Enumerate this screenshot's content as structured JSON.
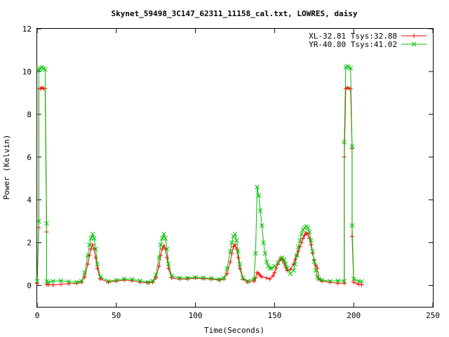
{
  "chart_data": {
    "type": "line",
    "title": "Skynet_59498_3C147_62311_11158_cal.txt, LOWRES, daisy",
    "xlabel": "Time(Seconds)",
    "ylabel": "Power (Kelvin)",
    "xlim": [
      0,
      250
    ],
    "ylim": [
      -1,
      12
    ],
    "xticks": [
      "0",
      "50",
      "100",
      "150",
      "200",
      "250"
    ],
    "yticks": [
      "0",
      "2",
      "4",
      "6",
      "8",
      "10",
      "12"
    ],
    "legend_position": "top-right",
    "grid": false,
    "series": [
      {
        "name": "XL-32.81 Tsys:32.88",
        "color": "#ff0000",
        "marker": "plus",
        "x": [
          0,
          1,
          1,
          2,
          3,
          4,
          5,
          6,
          6,
          7,
          10,
          15,
          20,
          25,
          28,
          30,
          32,
          33,
          34,
          35,
          36,
          37,
          38,
          40,
          45,
          50,
          55,
          60,
          65,
          70,
          73,
          75,
          77,
          78,
          79,
          80,
          81,
          82,
          83,
          85,
          90,
          95,
          100,
          105,
          110,
          115,
          118,
          120,
          122,
          123,
          124,
          125,
          126,
          127,
          128,
          130,
          133,
          137,
          138,
          139,
          140,
          141,
          142,
          145,
          147,
          149,
          150,
          151,
          152,
          153,
          154,
          155,
          156,
          157,
          158,
          160,
          162,
          163,
          164,
          165,
          166,
          167,
          168,
          169,
          170,
          171,
          172,
          173,
          174,
          175,
          176,
          177,
          178,
          180,
          185,
          190,
          194,
          194,
          195,
          196,
          197,
          198,
          199,
          199,
          200,
          203,
          205
        ],
        "y": [
          0.1,
          2.7,
          9.2,
          9.2,
          9.25,
          9.2,
          9.2,
          2.5,
          0.05,
          0.03,
          0.02,
          0.05,
          0.08,
          0.1,
          0.15,
          0.4,
          1.0,
          1.4,
          1.7,
          1.9,
          1.7,
          1.3,
          0.8,
          0.3,
          0.15,
          0.2,
          0.25,
          0.22,
          0.15,
          0.12,
          0.15,
          0.35,
          0.9,
          1.4,
          1.7,
          1.85,
          1.7,
          1.3,
          0.8,
          0.35,
          0.3,
          0.3,
          0.35,
          0.32,
          0.3,
          0.25,
          0.3,
          0.55,
          1.1,
          1.5,
          1.8,
          1.9,
          1.7,
          1.3,
          0.8,
          0.3,
          0.15,
          0.2,
          0.35,
          0.6,
          0.55,
          0.45,
          0.4,
          0.35,
          0.3,
          0.45,
          0.6,
          0.8,
          1.0,
          1.15,
          1.25,
          1.2,
          1.05,
          0.85,
          0.7,
          0.75,
          1.0,
          1.2,
          1.4,
          1.6,
          1.8,
          2.0,
          2.2,
          2.35,
          2.45,
          2.4,
          2.2,
          1.9,
          1.5,
          1.2,
          0.95,
          0.8,
          0.3,
          0.2,
          0.15,
          0.1,
          0.1,
          6.0,
          9.2,
          9.25,
          9.2,
          9.2,
          6.4,
          2.3,
          0.15,
          0.05,
          0.03
        ]
      },
      {
        "name": "YR-40.80 Tsys:41.02",
        "color": "#00c000",
        "marker": "x",
        "x": [
          0,
          1,
          1,
          2,
          3,
          4,
          5,
          6,
          6,
          7,
          10,
          15,
          20,
          25,
          28,
          30,
          32,
          33,
          34,
          35,
          36,
          37,
          38,
          40,
          45,
          50,
          55,
          60,
          65,
          70,
          73,
          75,
          77,
          78,
          79,
          80,
          81,
          82,
          83,
          85,
          90,
          95,
          100,
          105,
          110,
          115,
          118,
          120,
          122,
          123,
          124,
          125,
          126,
          127,
          128,
          130,
          133,
          137,
          138,
          139,
          140,
          141,
          142,
          143,
          144,
          145,
          146,
          147,
          148,
          150,
          152,
          154,
          155,
          156,
          157,
          158,
          160,
          162,
          163,
          164,
          165,
          166,
          167,
          168,
          169,
          170,
          171,
          172,
          173,
          174,
          175,
          176,
          177,
          178,
          180,
          185,
          190,
          194,
          194,
          195,
          196,
          197,
          198,
          199,
          199,
          200,
          203,
          205
        ],
        "y": [
          0.2,
          3.0,
          10.1,
          10.15,
          10.2,
          10.15,
          10.1,
          2.9,
          0.2,
          0.15,
          0.2,
          0.22,
          0.18,
          0.15,
          0.2,
          0.6,
          1.4,
          1.9,
          2.2,
          2.4,
          2.2,
          1.7,
          1.0,
          0.4,
          0.2,
          0.25,
          0.3,
          0.28,
          0.22,
          0.15,
          0.2,
          0.5,
          1.3,
          1.9,
          2.2,
          2.4,
          2.2,
          1.7,
          1.0,
          0.45,
          0.35,
          0.35,
          0.38,
          0.35,
          0.33,
          0.28,
          0.35,
          0.8,
          1.6,
          2.0,
          2.3,
          2.4,
          2.1,
          1.6,
          1.0,
          0.35,
          0.2,
          0.3,
          1.5,
          4.6,
          4.2,
          3.5,
          2.8,
          2.0,
          1.5,
          1.1,
          0.9,
          0.8,
          0.8,
          0.9,
          1.05,
          1.25,
          1.3,
          1.2,
          1.0,
          0.8,
          0.55,
          0.7,
          1.0,
          1.4,
          1.8,
          2.1,
          2.4,
          2.6,
          2.7,
          2.75,
          2.7,
          2.5,
          2.1,
          1.6,
          1.1,
          0.7,
          0.4,
          0.3,
          0.25,
          0.2,
          0.22,
          0.2,
          6.7,
          10.2,
          10.25,
          10.2,
          10.15,
          6.5,
          2.8,
          0.3,
          0.2,
          0.18
        ]
      }
    ]
  }
}
